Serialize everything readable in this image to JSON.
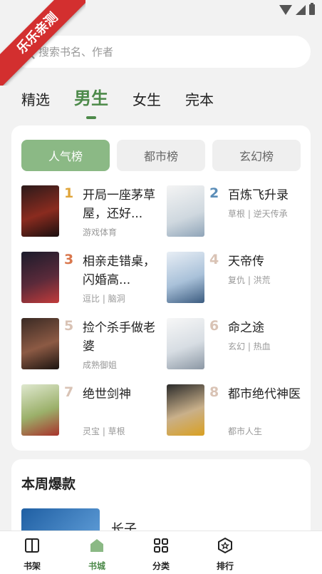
{
  "ribbon": {
    "text": "乐乐亲测"
  },
  "search": {
    "placeholder": "搜索书名、作者"
  },
  "top_tabs": [
    {
      "label": "精选"
    },
    {
      "label": "男生"
    },
    {
      "label": "女生"
    },
    {
      "label": "完本"
    }
  ],
  "rank_tabs": [
    {
      "label": "人气榜"
    },
    {
      "label": "都市榜"
    },
    {
      "label": "玄幻榜"
    }
  ],
  "books": [
    {
      "rank": "1",
      "title": "开局一座茅草屋，还好...",
      "tags": "游戏体育",
      "rank_color": "#e0a53a"
    },
    {
      "rank": "2",
      "title": "百炼飞升录",
      "tags": "草根 | 逆天传承",
      "rank_color": "#5b8db8"
    },
    {
      "rank": "3",
      "title": "相亲走错桌，闪婚高...",
      "tags": "逗比 | 脑洞",
      "rank_color": "#d9774d"
    },
    {
      "rank": "4",
      "title": "天帝传",
      "tags": "复仇 | 洪荒",
      "rank_color": "#d9c3b5"
    },
    {
      "rank": "5",
      "title": "捡个杀手做老婆",
      "tags": "成熟御姐",
      "rank_color": "#d9c3b5"
    },
    {
      "rank": "6",
      "title": "命之途",
      "tags": "玄幻 | 热血",
      "rank_color": "#d9c3b5"
    },
    {
      "rank": "7",
      "title": "绝世剑神",
      "tags": "灵宝 | 草根",
      "rank_color": "#d9c3b5"
    },
    {
      "rank": "8",
      "title": "都市绝代神医",
      "tags": "都市人生",
      "rank_color": "#d9c3b5"
    }
  ],
  "weekly": {
    "title": "本周爆款",
    "first_book_title": "长子"
  },
  "bottom_nav": [
    {
      "label": "书架",
      "icon": "book-icon"
    },
    {
      "label": "书城",
      "icon": "home-icon"
    },
    {
      "label": "分类",
      "icon": "grid-icon"
    },
    {
      "label": "排行",
      "icon": "rank-icon"
    }
  ],
  "colors": {
    "accent": "#4d8a4a",
    "active_tab_bg": "#8bb985"
  }
}
